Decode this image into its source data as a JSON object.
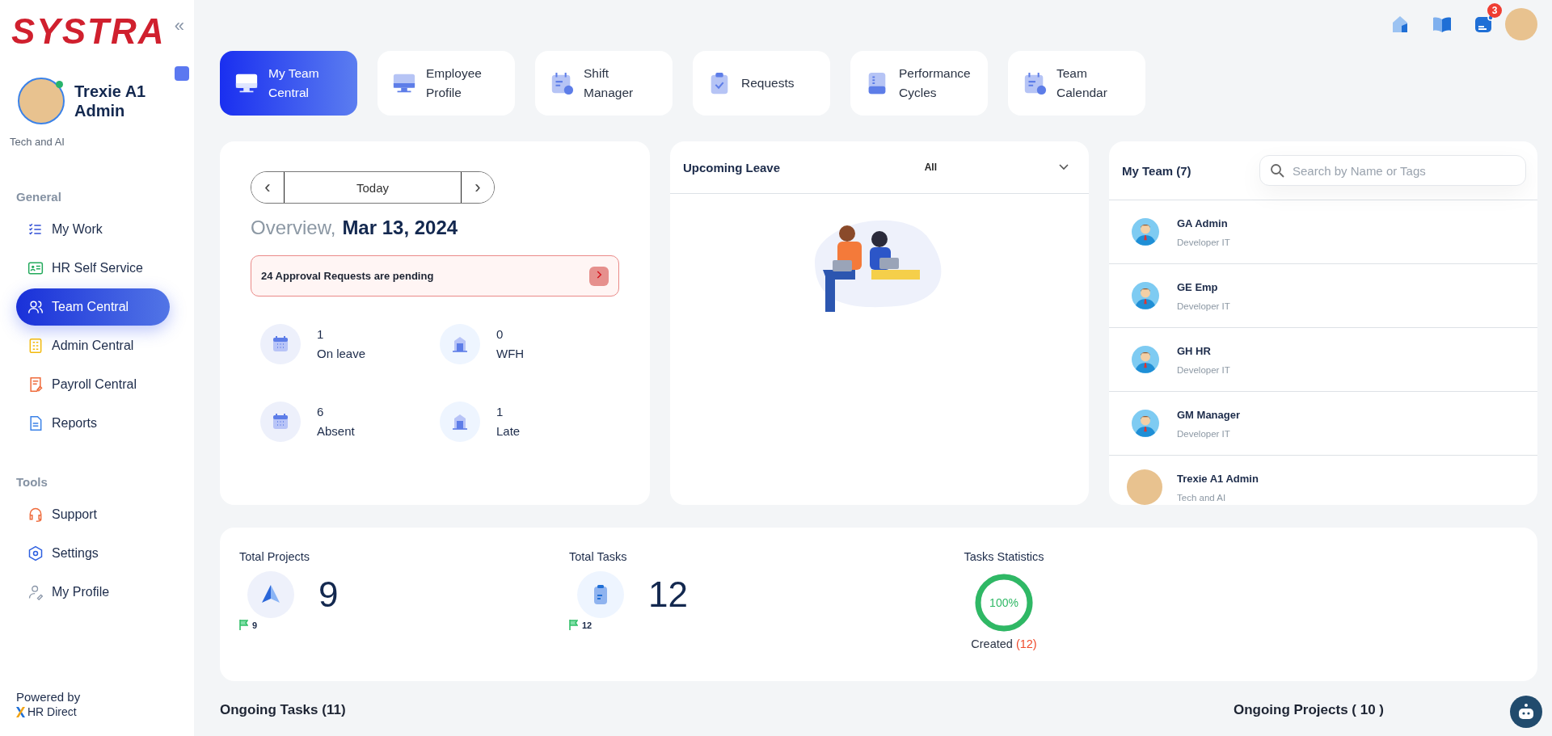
{
  "sidebar": {
    "logo": "SYSTRA",
    "collapse": "«",
    "user": {
      "name": "Trexie A1 Admin",
      "department": "Tech and AI",
      "online": true
    },
    "sections": [
      {
        "title": "General",
        "items": [
          {
            "label": "My Work",
            "selected": false
          },
          {
            "label": "HR Self Service",
            "selected": false
          },
          {
            "label": "Team Central",
            "selected": true
          },
          {
            "label": "Admin Central",
            "selected": false
          },
          {
            "label": "Payroll Central",
            "selected": false
          },
          {
            "label": "Reports",
            "selected": false
          }
        ]
      },
      {
        "title": "Tools",
        "items": [
          {
            "label": "Support",
            "selected": false
          },
          {
            "label": "Settings",
            "selected": false
          },
          {
            "label": "My Profile",
            "selected": false
          }
        ]
      }
    ],
    "footer": {
      "caption": "Powered by",
      "brand": "HR Direct"
    }
  },
  "header": {
    "notification_count": "3"
  },
  "tabs": [
    {
      "label": "My Team Central",
      "selected": true
    },
    {
      "label": "Employee Profile",
      "selected": false
    },
    {
      "label": "Shift Manager",
      "selected": false
    },
    {
      "label": "Requests",
      "selected": false
    },
    {
      "label": "Performance Cycles",
      "selected": false
    },
    {
      "label": "Team Calendar",
      "selected": false
    }
  ],
  "overview": {
    "prev": "‹",
    "date_button": "Today",
    "next": "›",
    "title": "Overview,",
    "date": "Mar 13, 2024",
    "alert": "24 Approval Requests are pending",
    "stats": [
      {
        "value": "1",
        "label": "On leave",
        "kind": "calendar"
      },
      {
        "value": "0",
        "label": "WFH",
        "kind": "building"
      },
      {
        "value": "6",
        "label": "Absent",
        "kind": "calendar"
      },
      {
        "value": "1",
        "label": "Late",
        "kind": "building"
      }
    ]
  },
  "upcoming_leave": {
    "title": "Upcoming Leave",
    "filter": "All"
  },
  "my_team": {
    "title": "My Team (7)",
    "search": {
      "placeholder": "Search by Name or Tags"
    },
    "members": [
      {
        "name": "GA Admin",
        "role": "Developer IT",
        "kind": "cartoon"
      },
      {
        "name": "GE Emp",
        "role": "Developer IT",
        "kind": "cartoon"
      },
      {
        "name": "GH HR",
        "role": "Developer IT",
        "kind": "cartoon"
      },
      {
        "name": "GM Manager",
        "role": "Developer IT",
        "kind": "cartoon"
      },
      {
        "name": "Trexie A1 Admin",
        "role": "Tech and AI",
        "kind": "photo"
      }
    ]
  },
  "summary": {
    "projects": {
      "title": "Total Projects",
      "value": "9",
      "flag_count": "9"
    },
    "tasks": {
      "title": "Total Tasks",
      "value": "12",
      "flag_count": "12"
    },
    "statistics": {
      "title": "Tasks Statistics",
      "level": 1,
      "reading": "100%",
      "label": "Created",
      "count": "(12)"
    }
  },
  "sections": [
    {
      "title": "Ongoing Tasks (11)"
    },
    {
      "title": "Ongoing Projects ( 10 )"
    }
  ]
}
